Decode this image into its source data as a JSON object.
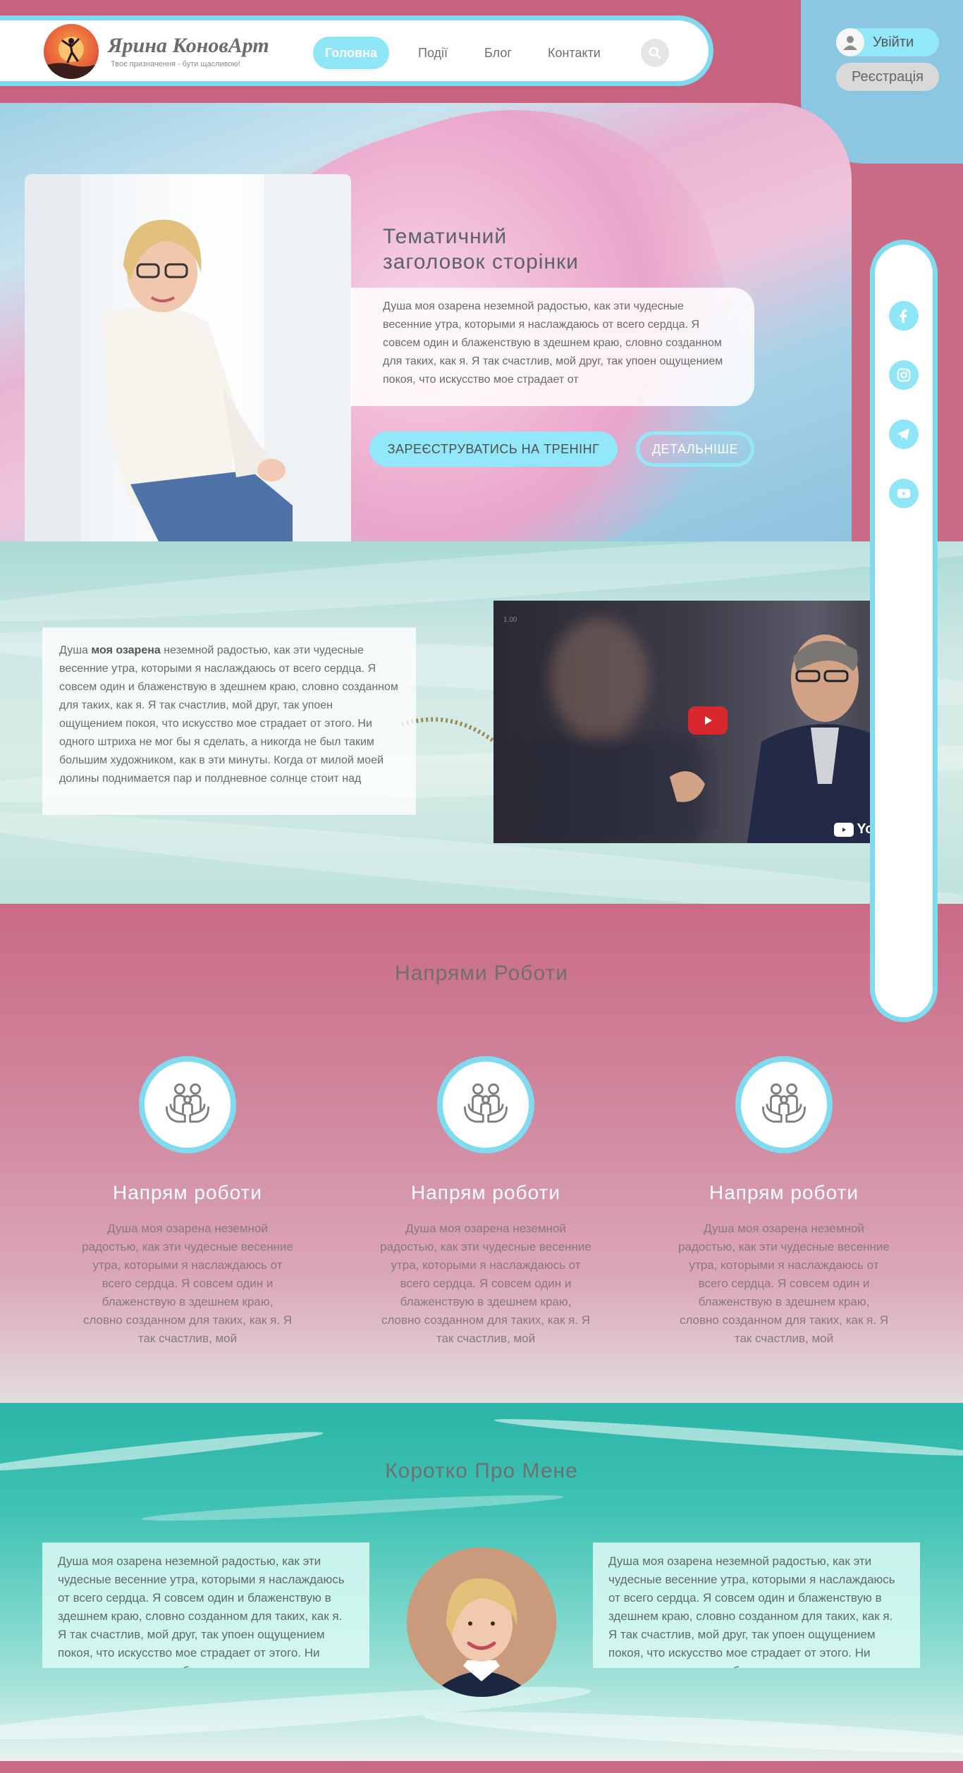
{
  "header": {
    "brand_name": "Ярина КоновАрт",
    "brand_tagline": "Твоє призначення - бути щасливою!",
    "nav": [
      {
        "label": "Головна",
        "active": true
      },
      {
        "label": "Події",
        "active": false
      },
      {
        "label": "Блог",
        "active": false
      },
      {
        "label": "Контакти",
        "active": false
      }
    ],
    "search_icon": "search-icon",
    "login_label": "Увійти",
    "register_label": "Реєстрація"
  },
  "hero": {
    "title_line1": "Тематичний",
    "title_line2": "заголовок сторінки",
    "text": "Душа моя озарена неземной радостью, как эти чудесные весенние утра, которыми я наслаждаюсь от всего сердца. Я совсем один и блаженствую в здешнем краю, словно созданном для таких, как я. Я так счастлив, мой друг, так упоен ощущением покоя, что искусство мое страдает от",
    "primary_button": "ЗАРЕЄСТРУВАТИСЬ НА ТРЕНІНГ",
    "secondary_button": "ДЕТАЛЬНІШЕ"
  },
  "social": [
    "facebook-icon",
    "instagram-icon",
    "telegram-icon",
    "youtube-icon"
  ],
  "video_section": {
    "text_prefix": "Душа ",
    "text_bold": "моя озарена",
    "text_rest": " неземной радостью, как эти чудесные весенние утра, которыми я наслаждаюсь от всего сердца. Я совсем один и блаженствую в здешнем краю, словно созданном для таких, как я. Я так счастлив, мой друг, так упоен ощущением покоя, что искусство мое страдает от этого. Ни одного штриха не мог бы я сделать, а никогда не был таким большим художником, как в эти минуты. Когда от милой моей долины поднимается пар и полдневное солнце стоит над",
    "video_timer": "1.00",
    "video_brand": "YouTube"
  },
  "directions": {
    "title": "Напрями Роботи",
    "cards": [
      {
        "title": "Напрям роботи",
        "text": "Душа моя озарена неземной радостью, как эти чудесные весенние утра, которыми я наслаждаюсь от всего сердца. Я совсем один и блаженствую в здешнем краю, словно созданном для таких, как я. Я так счастлив, мой"
      },
      {
        "title": "Напрям роботи",
        "text": "Душа моя озарена неземной радостью, как эти чудесные весенние утра, которыми я наслаждаюсь от всего сердца. Я совсем один и блаженствую в здешнем краю, словно созданном для таких, как я. Я так счастлив, мой"
      },
      {
        "title": "Напрям роботи",
        "text": "Душа моя озарена неземной радостью, как эти чудесные весенние утра, которыми я наслаждаюсь от всего сердца. Я совсем один и блаженствую в здешнем краю, словно созданном для таких, как я. Я так счастлив, мой"
      }
    ]
  },
  "about": {
    "title": "Коротко Про Мене",
    "left_text": "Душа моя озарена неземной радостью, как эти чудесные весенние утра, которыми я наслаждаюсь от всего сердца. Я совсем один и блаженствую в здешнем краю, словно созданном для таких, как я. Я так счастлив, мой друг, так упоен ощущением покоя, что искусство мое страдает от этого. Ни одного штриха не мог бы я",
    "right_text": "Душа моя озарена неземной радостью, как эти чудесные весенние утра, которыми я наслаждаюсь от всего сердца. Я совсем один и блаженствую в здешнем краю, словно созданном для таких, как я. Я так счастлив, мой друг, так упоен ощущением покоя, что искусство мое страдает от этого. Ни одного штриха не мог бы я"
  },
  "colors": {
    "accent_cyan": "#8fe6f6",
    "rose": "#c96b85",
    "sky": "#8cc7e2"
  }
}
